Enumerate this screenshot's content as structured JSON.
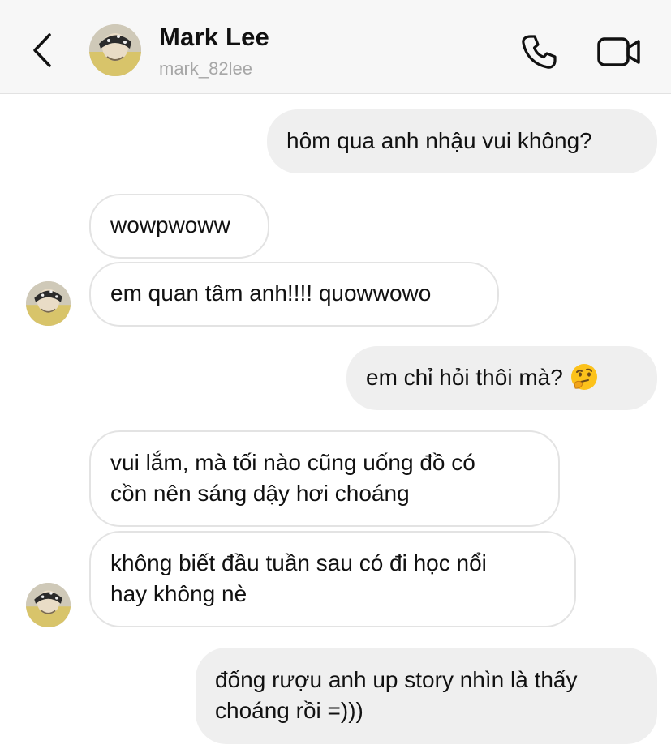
{
  "header": {
    "contact_name": "Mark Lee",
    "contact_handle": "mark_82lee",
    "icons": {
      "back": "chevron-left-icon",
      "call": "phone-icon",
      "video": "video-camera-icon"
    }
  },
  "messages": [
    {
      "side": "sent",
      "lines": [
        "hôm qua anh nhậu vui không?"
      ]
    },
    {
      "side": "received",
      "lines": [
        "wowpwoww"
      ]
    },
    {
      "side": "received",
      "lines": [
        "em quan tâm anh!!!! quowwowo"
      ]
    },
    {
      "side": "sent",
      "lines": [
        "em chỉ hỏi thôi mà?"
      ],
      "emoji": "thinking-face-emoji"
    },
    {
      "side": "received",
      "lines": [
        "vui lắm, mà tối nào cũng uống đồ có",
        "cồn nên sáng dậy hơi choáng"
      ]
    },
    {
      "side": "received",
      "lines": [
        "không biết đầu tuần sau có đi học nổi",
        "hay không nè"
      ]
    },
    {
      "side": "sent",
      "lines": [
        "đống rượu anh up story nhìn là thấy",
        "choáng rồi =)))"
      ]
    }
  ],
  "colors": {
    "sent_bubble": "#efefef",
    "received_border": "#e3e3e3",
    "header_bg": "#f7f7f7",
    "handle_text": "#a7a7a7"
  }
}
